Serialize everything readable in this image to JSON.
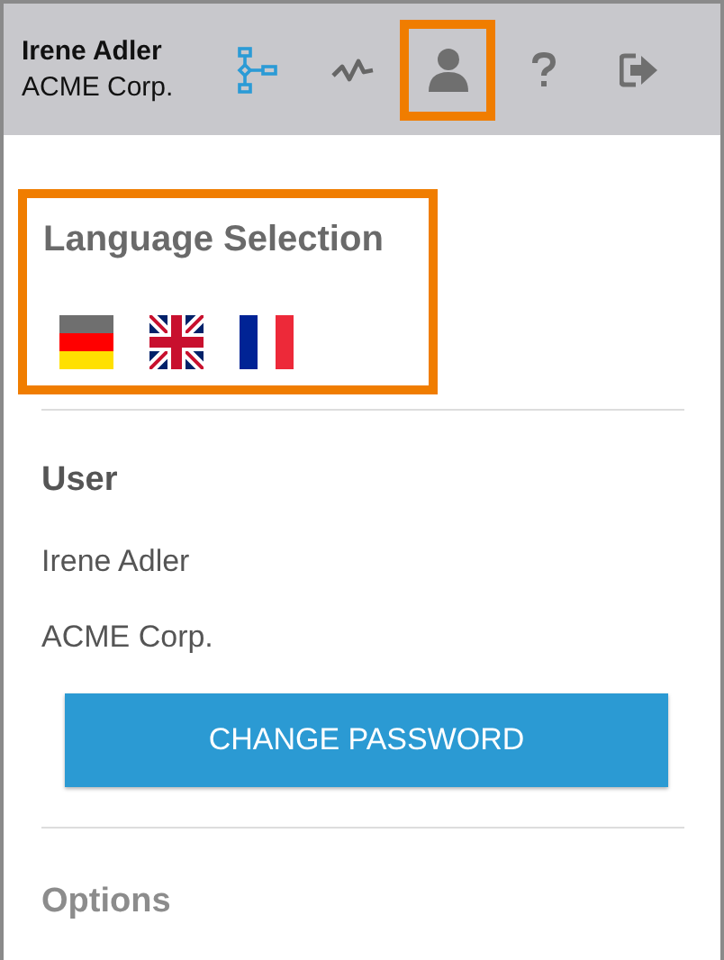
{
  "header": {
    "user_name": "Irene Adler",
    "company": "ACME Corp.",
    "toolbar": [
      {
        "kind": "flowchart",
        "highlighted": false
      },
      {
        "kind": "activity",
        "highlighted": false
      },
      {
        "kind": "user",
        "highlighted": true
      },
      {
        "kind": "help",
        "highlighted": false
      },
      {
        "kind": "logout",
        "highlighted": false
      }
    ]
  },
  "language_section": {
    "title": "Language Selection",
    "highlighted": true,
    "flags": [
      {
        "kind": "de"
      },
      {
        "kind": "gb"
      },
      {
        "kind": "fr"
      }
    ]
  },
  "user_section": {
    "title": "User",
    "name": "Irene Adler",
    "company": "ACME Corp.",
    "button": "CHANGE PASSWORD"
  },
  "options_section": {
    "title": "Options"
  }
}
